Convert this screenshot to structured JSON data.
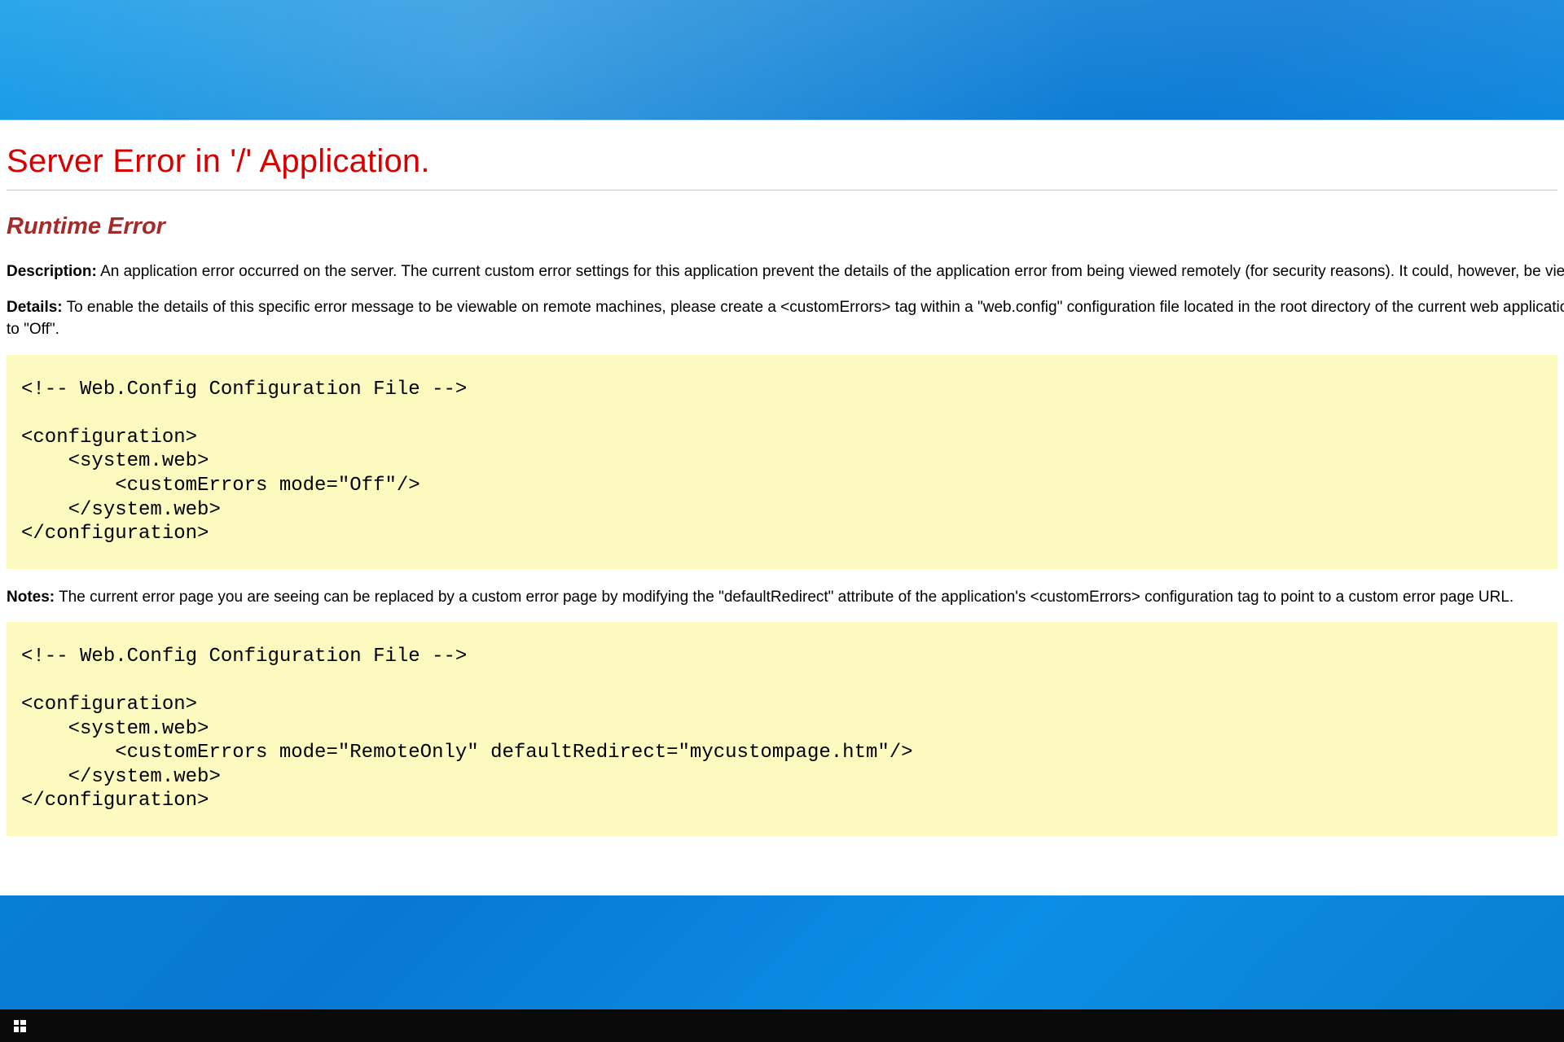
{
  "error": {
    "title": "Server Error in '/' Application.",
    "subtitle": "Runtime Error",
    "description_label": "Description:",
    "description_text": "An application error occurred on the server. The current custom error settings for this application prevent the details of the application error from being viewed remotely (for security reasons). It could, however, be viewed by browsers running on the local server machine.",
    "details_label": "Details:",
    "details_text_1": "To enable the details of this specific error message to be viewable on remote machines, please create a <customErrors> tag within a \"web.config\" configuration file located in the root directory of the current web application. This <customErrors> tag should then have its \"mode\" attribute set",
    "details_text_2": "to \"Off\".",
    "code1": "<!-- Web.Config Configuration File -->\n\n<configuration>\n    <system.web>\n        <customErrors mode=\"Off\"/>\n    </system.web>\n</configuration>",
    "notes_label": "Notes:",
    "notes_text": "The current error page you are seeing can be replaced by a custom error page by modifying the \"defaultRedirect\" attribute of the application's <customErrors> configuration tag to point to a custom error page URL.",
    "code2": "<!-- Web.Config Configuration File -->\n\n<configuration>\n    <system.web>\n        <customErrors mode=\"RemoteOnly\" defaultRedirect=\"mycustompage.htm\"/>\n    </system.web>\n</configuration>"
  }
}
